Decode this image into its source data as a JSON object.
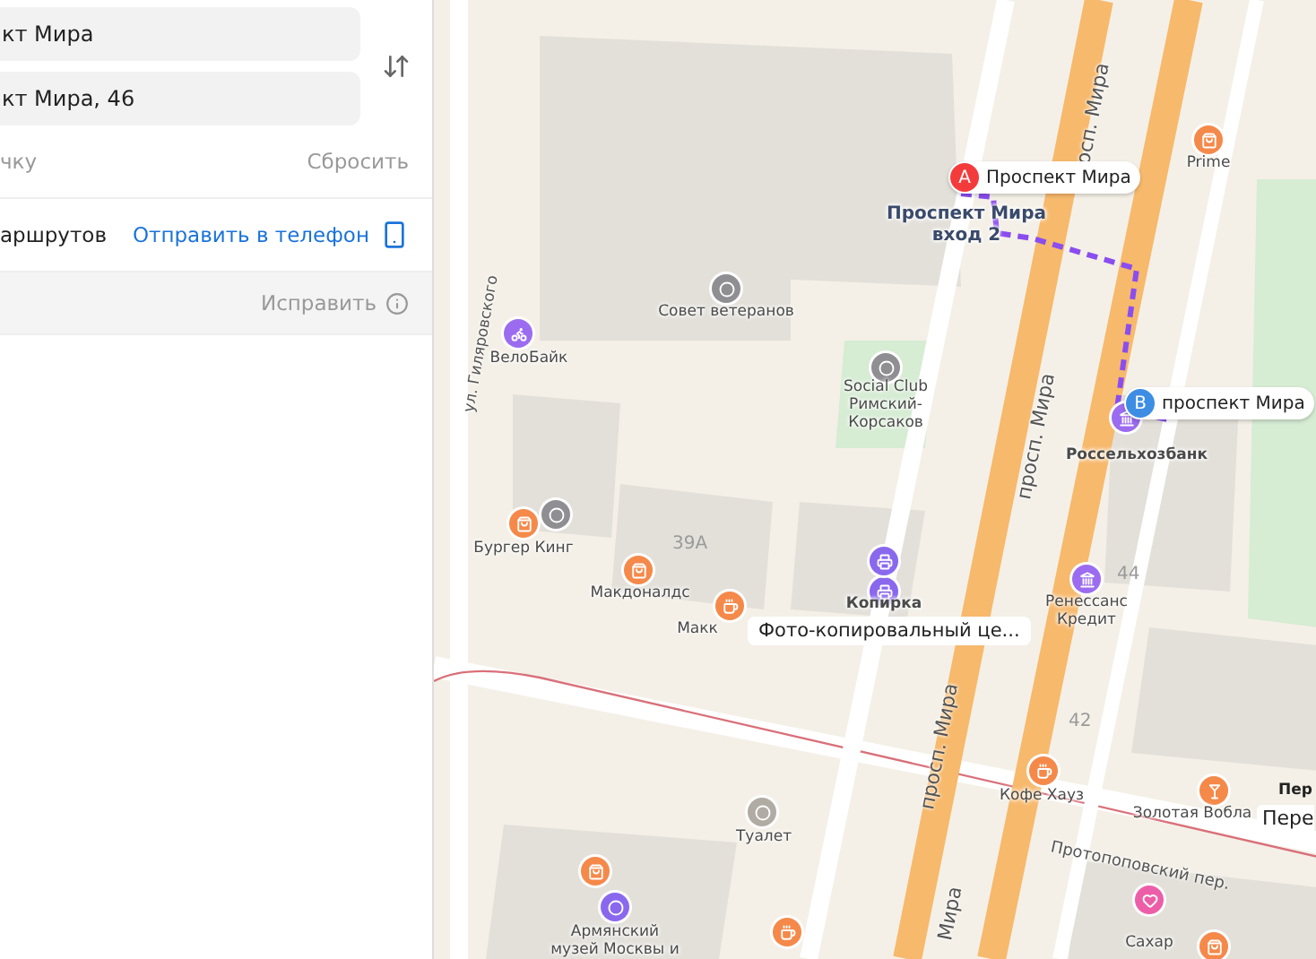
{
  "route_panel": {
    "from_field": {
      "value": "кт Мира"
    },
    "to_field": {
      "value": "кт Мира, 46"
    },
    "add_point": "чку",
    "reset": "Сбросить",
    "routes_label": "аршрутов",
    "send_to_phone": "Отправить в телефон",
    "fix": "Исправить"
  },
  "map": {
    "route_points": [
      {
        "letter": "A",
        "label": "Проспект Мира",
        "color": "#f43b3b"
      },
      {
        "letter": "B",
        "label": "проспект Мира",
        "color": "#3d8de4"
      }
    ],
    "entrance": "Проспект Мира\nвход 2",
    "callout": "Фото-копировальный це...",
    "streets": [
      {
        "name": "осп. Мира"
      },
      {
        "name": "просп. Мира"
      },
      {
        "name": "просп. Мира"
      },
      {
        "name": "Мира"
      },
      {
        "name": "ул. Гиляровского"
      },
      {
        "name": "Протопоповский пер."
      }
    ],
    "house_numbers": [
      "39А",
      "44",
      "42"
    ],
    "places": [
      {
        "name": "Совет ветеранов",
        "kind": "landmark",
        "bold": false
      },
      {
        "name": "ВелоБайк",
        "kind": "bike",
        "bold": false
      },
      {
        "name": "Social Club\nРимский-\nКорсаков",
        "kind": "landmark",
        "bold": false
      },
      {
        "name": "Prime",
        "kind": "shop",
        "bold": false
      },
      {
        "name": "Россельхозбанк",
        "kind": "bank",
        "bold": true
      },
      {
        "name": "Бургер Кинг",
        "kind": "shop",
        "bold": false
      },
      {
        "name": "Макдоналдс",
        "kind": "shop",
        "bold": false
      },
      {
        "name": "Копирка",
        "kind": "printer",
        "bold": true
      },
      {
        "name": "Ренессанс\nКредит",
        "kind": "bank",
        "bold": false
      },
      {
        "name": "Кофе Хауз",
        "kind": "cafe",
        "bold": false
      },
      {
        "name": "Золотая Вобла",
        "kind": "bar",
        "bold": false
      },
      {
        "name": "Туалет",
        "kind": "toilet",
        "bold": false
      },
      {
        "name": "Армянский\nмузей Москвы и",
        "kind": "museum",
        "bold": false
      },
      {
        "name": "Сахар",
        "kind": "beauty",
        "bold": false
      },
      {
        "name": "Макк",
        "kind": "cafe",
        "bold": false
      }
    ],
    "edge_labels": [
      {
        "text": "Пер",
        "kind": "bold"
      },
      {
        "text": "Пере",
        "kind": "pill"
      }
    ]
  }
}
